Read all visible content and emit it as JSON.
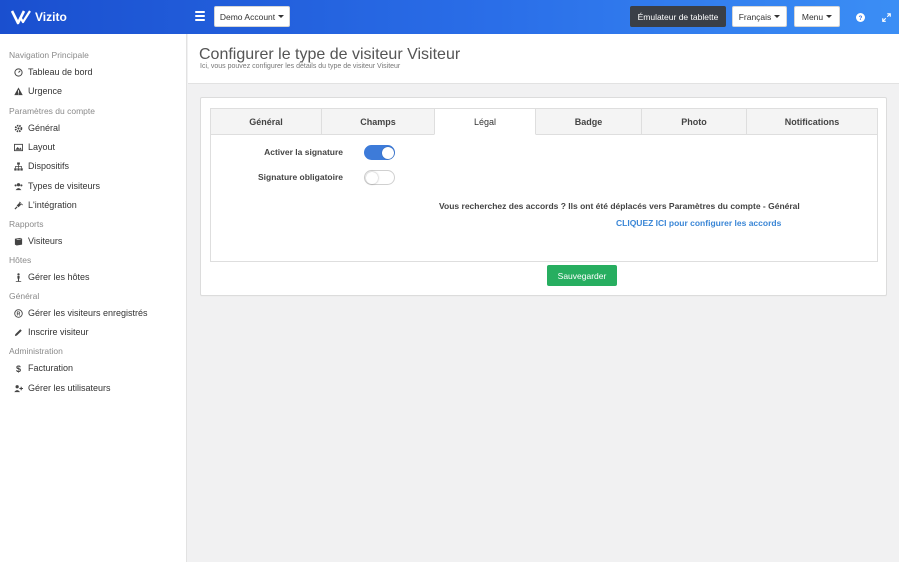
{
  "app": {
    "logo_text": "Vizito"
  },
  "topbar": {
    "account_label": "Demo Account",
    "emulator_label": "Émulateur de tablette",
    "language_label": "Français",
    "menu_label": "Menu"
  },
  "sidebar": {
    "sections": [
      {
        "title": "Navigation Principale",
        "items": [
          {
            "label": "Tableau de bord",
            "icon": "dashboard-icon"
          },
          {
            "label": "Urgence",
            "icon": "warning-icon"
          }
        ]
      },
      {
        "title": "Paramètres du compte",
        "items": [
          {
            "label": "Général",
            "icon": "gear-icon"
          },
          {
            "label": "Layout",
            "icon": "image-icon"
          },
          {
            "label": "Dispositifs",
            "icon": "sitemap-icon"
          },
          {
            "label": "Types de visiteurs",
            "icon": "users-icon"
          },
          {
            "label": "L'intégration",
            "icon": "plug-icon"
          }
        ]
      },
      {
        "title": "Rapports",
        "items": [
          {
            "label": "Visiteurs",
            "icon": "book-icon"
          }
        ]
      },
      {
        "title": "Hôtes",
        "items": [
          {
            "label": "Gérer les hôtes",
            "icon": "person-icon"
          }
        ]
      },
      {
        "title": "Général",
        "items": [
          {
            "label": "Gérer les visiteurs enregistrés",
            "icon": "registered-icon"
          },
          {
            "label": "Inscrire visiteur",
            "icon": "pencil-icon"
          }
        ]
      },
      {
        "title": "Administration",
        "items": [
          {
            "label": "Facturation",
            "icon": "dollar-icon"
          },
          {
            "label": "Gérer les utilisateurs",
            "icon": "user-plus-icon"
          }
        ]
      }
    ]
  },
  "header": {
    "title": "Configurer le type de visiteur Visiteur",
    "subtitle": "Ici, vous pouvez configurer les détails du type de visiteur Visiteur"
  },
  "tabs": [
    {
      "label": "Général"
    },
    {
      "label": "Champs"
    },
    {
      "label": "Légal"
    },
    {
      "label": "Badge"
    },
    {
      "label": "Photo"
    },
    {
      "label": "Notifications"
    }
  ],
  "active_tab": "Légal",
  "legal": {
    "signature_label": "Activer la signature",
    "signature_enabled": true,
    "required_label": "Signature obligatoire",
    "required_enabled": false,
    "notice": "Vous recherchez des accords ? Ils ont été déplacés vers Paramètres du compte - Général",
    "link": "CLIQUEZ ICI pour configurer les accords"
  },
  "save_label": "Sauvegarder",
  "colors": {
    "accent": "#2a6ee8",
    "toggle_on": "#3d7bd9",
    "save": "#27ae60",
    "link": "#3a86d6"
  }
}
